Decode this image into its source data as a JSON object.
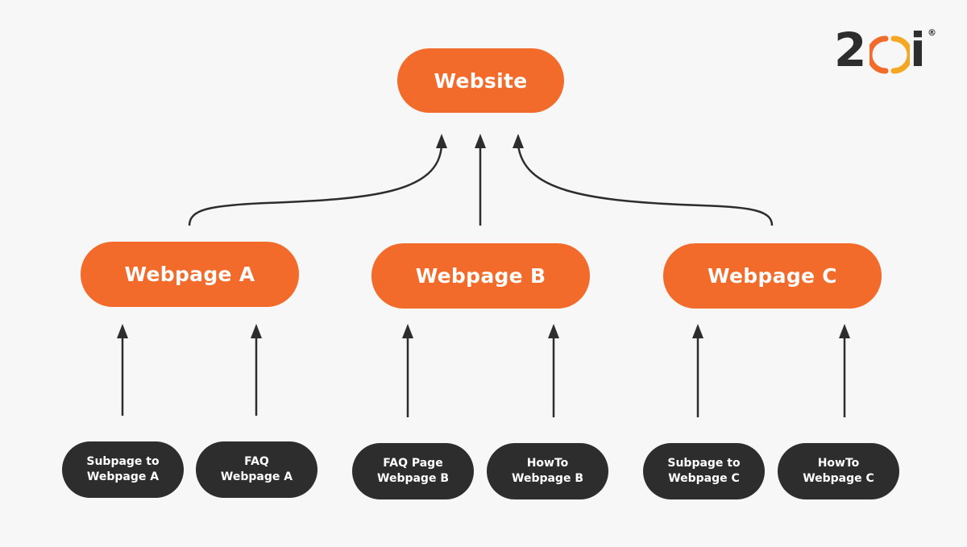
{
  "brand": {
    "logo_digit": "2",
    "logo_letter": "i",
    "registered_mark": "®",
    "colors": {
      "orange": "#f26b2a",
      "dark": "#2d2d2d",
      "logo_yellow": "#f5a623",
      "background": "#f7f7f7"
    }
  },
  "root": {
    "label": "Website"
  },
  "pages": [
    {
      "label": "Webpage A",
      "children": [
        {
          "line1": "Subpage to",
          "line2": "Webpage A"
        },
        {
          "line1": "FAQ",
          "line2": "Webpage A"
        }
      ]
    },
    {
      "label": "Webpage B",
      "children": [
        {
          "line1": "FAQ Page",
          "line2": "Webpage B"
        },
        {
          "line1": "HowTo",
          "line2": "Webpage B"
        }
      ]
    },
    {
      "label": "Webpage C",
      "children": [
        {
          "line1": "Subpage to",
          "line2": "Webpage C"
        },
        {
          "line1": "HowTo",
          "line2": "Webpage C"
        }
      ]
    }
  ]
}
